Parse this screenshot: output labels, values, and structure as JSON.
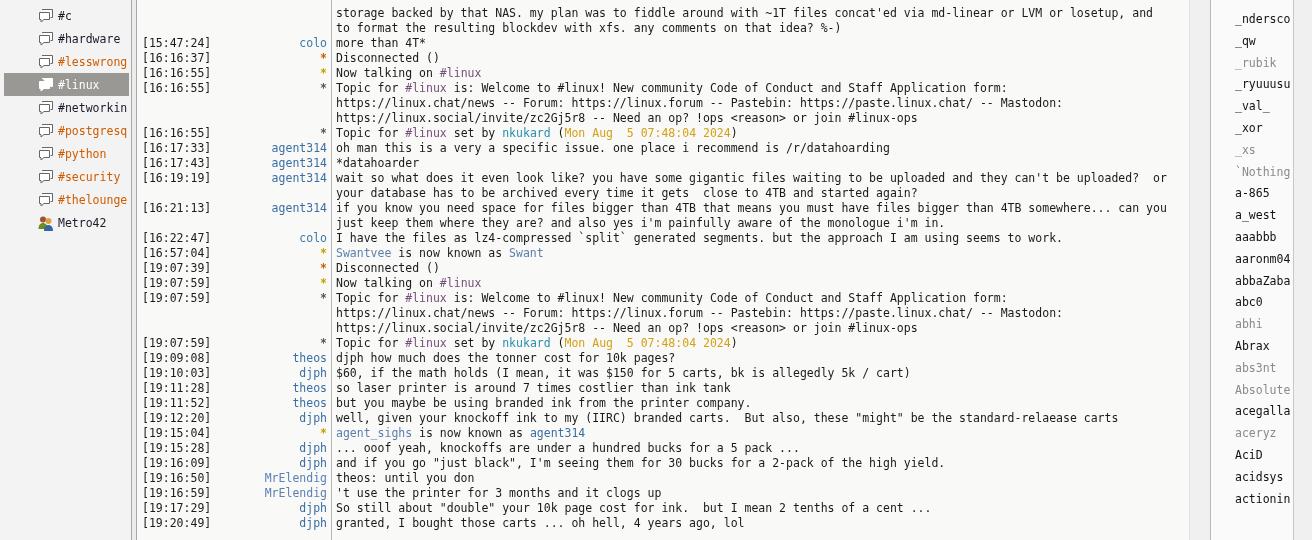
{
  "channels": [
    {
      "label": "#c",
      "kind": "channel",
      "activity": false,
      "selected": false
    },
    {
      "label": "#hardware",
      "kind": "channel",
      "activity": false,
      "selected": false
    },
    {
      "label": "#lesswrong",
      "kind": "channel",
      "activity": true,
      "selected": false
    },
    {
      "label": "#linux",
      "kind": "channel",
      "activity": false,
      "selected": true
    },
    {
      "label": "#networkin",
      "kind": "channel",
      "activity": false,
      "selected": false
    },
    {
      "label": "#postgresq",
      "kind": "channel",
      "activity": true,
      "selected": false
    },
    {
      "label": "#python",
      "kind": "channel",
      "activity": true,
      "selected": false
    },
    {
      "label": "#security",
      "kind": "channel",
      "activity": true,
      "selected": false
    },
    {
      "label": "#thelounge",
      "kind": "channel",
      "activity": true,
      "selected": false
    },
    {
      "label": "Metro42",
      "kind": "query",
      "activity": false,
      "selected": false
    }
  ],
  "messages": [
    {
      "lines": [
        [
          "storage backed by that NAS. my plan was to fiddle around with ~1T files concat'ed via md-linear or LVM or losetup, and"
        ],
        [
          "to format the resulting blockdev with xfs. any comments on that idea? %-)"
        ]
      ]
    },
    {
      "time": "[15:47:24]",
      "nick": "colo",
      "color": "#3d78a8",
      "lines": [
        [
          "more than 4T*"
        ]
      ]
    },
    {
      "time": "[16:16:37]",
      "nick": "*",
      "color": "#ce5c00",
      "lines": [
        [
          "Disconnected ()"
        ]
      ]
    },
    {
      "time": "[16:16:55]",
      "nick": "*",
      "color": "#c4a000",
      "lines": [
        [
          "Now talking on ",
          {
            "t": "#linux",
            "color": "#75507b"
          }
        ]
      ]
    },
    {
      "time": "[16:16:55]",
      "nick": "*",
      "color": "#555753",
      "lines": [
        [
          "Topic for ",
          {
            "t": "#linux",
            "color": "#75507b"
          },
          " is: Welcome to #linux! New community Code of Conduct and Staff Application form:"
        ],
        [
          "https://linux.chat/news -- Forum: https://linux.forum -- Pastebin: https://paste.linux.chat/ -- Mastodon:"
        ],
        [
          "https://linux.social/invite/zc2Gj5r8 -- Need an op? !ops <reason> or join #linux-ops"
        ]
      ]
    },
    {
      "time": "[16:16:55]",
      "nick": "*",
      "color": "#555753",
      "lines": [
        [
          "Topic for ",
          {
            "t": "#linux",
            "color": "#75507b"
          },
          " set by ",
          {
            "t": "nkukard",
            "color": "#2a8fae"
          },
          " (",
          {
            "t": "Mon Aug  5 07:48:04 2024",
            "color": "#d4a017"
          },
          ")"
        ]
      ]
    },
    {
      "time": "[16:17:33]",
      "nick": "agent314",
      "color": "#3b6ea5",
      "lines": [
        [
          "oh man this is a very a specific issue. one place i recommend is /r/datahoarding"
        ]
      ]
    },
    {
      "time": "[16:17:43]",
      "nick": "agent314",
      "color": "#3b6ea5",
      "lines": [
        [
          "*datahoarder"
        ]
      ]
    },
    {
      "time": "[16:19:19]",
      "nick": "agent314",
      "color": "#3b6ea5",
      "lines": [
        [
          "wait so what does it even look like? you have some gigantic files waiting to be uploaded and they can't be uploaded?  or"
        ],
        [
          "your database has to be archived every time it gets  close to 4TB and started again?"
        ]
      ]
    },
    {
      "time": "[16:21:13]",
      "nick": "agent314",
      "color": "#3b6ea5",
      "lines": [
        [
          "if you know you need space for files bigger than 4TB that means you must have files bigger than 4TB somewhere... can you"
        ],
        [
          "just keep them where they are? and also yes i'm painfully aware of the monologue i'm in."
        ]
      ]
    },
    {
      "time": "[16:22:47]",
      "nick": "colo",
      "color": "#3d78a8",
      "lines": [
        [
          "I have the files as lz4-compressed `split` generated segments. but the approach I am using seems to work."
        ]
      ]
    },
    {
      "time": "[16:57:04]",
      "nick": "*",
      "color": "#c4a000",
      "lines": [
        [
          {
            "t": "Swantvee",
            "color": "#5b7fae"
          },
          " is now known as ",
          {
            "t": "Swant",
            "color": "#5b7fae"
          }
        ]
      ]
    },
    {
      "time": "[19:07:39]",
      "nick": "*",
      "color": "#ce5c00",
      "lines": [
        [
          "Disconnected ()"
        ]
      ]
    },
    {
      "time": "[19:07:59]",
      "nick": "*",
      "color": "#c4a000",
      "lines": [
        [
          "Now talking on ",
          {
            "t": "#linux",
            "color": "#75507b"
          }
        ]
      ]
    },
    {
      "time": "[19:07:59]",
      "nick": "*",
      "color": "#555753",
      "lines": [
        [
          "Topic for ",
          {
            "t": "#linux",
            "color": "#75507b"
          },
          " is: Welcome to #linux! New community Code of Conduct and Staff Application form:"
        ],
        [
          "https://linux.chat/news -- Forum: https://linux.forum -- Pastebin: https://paste.linux.chat/ -- Mastodon:"
        ],
        [
          "https://linux.social/invite/zc2Gj5r8 -- Need an op? !ops <reason> or join #linux-ops"
        ]
      ]
    },
    {
      "time": "[19:07:59]",
      "nick": "*",
      "color": "#555753",
      "lines": [
        [
          "Topic for ",
          {
            "t": "#linux",
            "color": "#75507b"
          },
          " set by ",
          {
            "t": "nkukard",
            "color": "#2a8fae"
          },
          " (",
          {
            "t": "Mon Aug  5 07:48:04 2024",
            "color": "#d4a017"
          },
          ")"
        ]
      ]
    },
    {
      "time": "[19:09:08]",
      "nick": "theos",
      "color": "#3b6ea5",
      "lines": [
        [
          "djph how much does the tonner cost for 10k pages?"
        ]
      ]
    },
    {
      "time": "[19:10:03]",
      "nick": "djph",
      "color": "#3b6ea5",
      "lines": [
        [
          "$60, if the math holds (I mean, it was $150 for 5 carts, bk is allegedly 5k / cart)"
        ]
      ]
    },
    {
      "time": "[19:11:28]",
      "nick": "theos",
      "color": "#3b6ea5",
      "lines": [
        [
          "so laser printer is around 7 times costlier than ink tank"
        ]
      ]
    },
    {
      "time": "[19:11:52]",
      "nick": "theos",
      "color": "#3b6ea5",
      "lines": [
        [
          "but you maybe be using branded ink from the printer company."
        ]
      ]
    },
    {
      "time": "[19:12:20]",
      "nick": "djph",
      "color": "#3b6ea5",
      "lines": [
        [
          "well, given your knockoff ink to my (IIRC) branded carts.  But also, these \"might\" be the standard-relaease carts"
        ]
      ]
    },
    {
      "time": "[19:15:04]",
      "nick": "*",
      "color": "#c4a000",
      "lines": [
        [
          {
            "t": "agent_sighs",
            "color": "#5b7fae"
          },
          " is now known as ",
          {
            "t": "agent314",
            "color": "#3b6ea5"
          }
        ]
      ]
    },
    {
      "time": "[19:15:28]",
      "nick": "djph",
      "color": "#3b6ea5",
      "lines": [
        [
          "... ooof yeah, knockoffs are under a hundred bucks for a 5 pack ..."
        ]
      ]
    },
    {
      "time": "[19:16:09]",
      "nick": "djph",
      "color": "#3b6ea5",
      "lines": [
        [
          "and if you go \"just black\", I'm seeing them for 30 bucks for a 2-pack of the high yield."
        ]
      ]
    },
    {
      "time": "[19:16:50]",
      "nick": "MrElendig",
      "color": "#5c7fb5",
      "lines": [
        [
          "theos: until you don"
        ]
      ]
    },
    {
      "time": "[19:16:59]",
      "nick": "MrElendig",
      "color": "#5c7fb5",
      "lines": [
        [
          "'t use the printer for 3 months and it clogs up"
        ]
      ]
    },
    {
      "time": "[19:17:29]",
      "nick": "djph",
      "color": "#3b6ea5",
      "lines": [
        [
          "So still about \"double\" your 10k page cost for ink.  but I mean 2 tenths of a cent ..."
        ]
      ]
    },
    {
      "time": "[19:20:49]",
      "nick": "djph",
      "color": "#3b6ea5",
      "lines": [
        [
          "granted, I bought those carts ... oh hell, 4 years ago, lol"
        ]
      ]
    }
  ],
  "users": [
    {
      "name": "_ndersco",
      "away": false
    },
    {
      "name": "_qw",
      "away": false
    },
    {
      "name": "_rubik",
      "away": true
    },
    {
      "name": "_ryuuusu",
      "away": false
    },
    {
      "name": "_val_",
      "away": false
    },
    {
      "name": "_xor",
      "away": false
    },
    {
      "name": "_xs",
      "away": true
    },
    {
      "name": "`Nothing",
      "away": true
    },
    {
      "name": "a-865",
      "away": false
    },
    {
      "name": "a_west",
      "away": false
    },
    {
      "name": "aaabbb",
      "away": false
    },
    {
      "name": "aaronm04",
      "away": false
    },
    {
      "name": "abbaZaba",
      "away": false
    },
    {
      "name": "abc0",
      "away": false
    },
    {
      "name": "abhi",
      "away": true
    },
    {
      "name": "Abrax",
      "away": false
    },
    {
      "name": "abs3nt",
      "away": true
    },
    {
      "name": "Absolute",
      "away": true
    },
    {
      "name": "acegalla",
      "away": false
    },
    {
      "name": "aceryz",
      "away": true
    },
    {
      "name": "AciD",
      "away": false
    },
    {
      "name": "acidsys",
      "away": false
    },
    {
      "name": "actionin",
      "away": false
    }
  ]
}
